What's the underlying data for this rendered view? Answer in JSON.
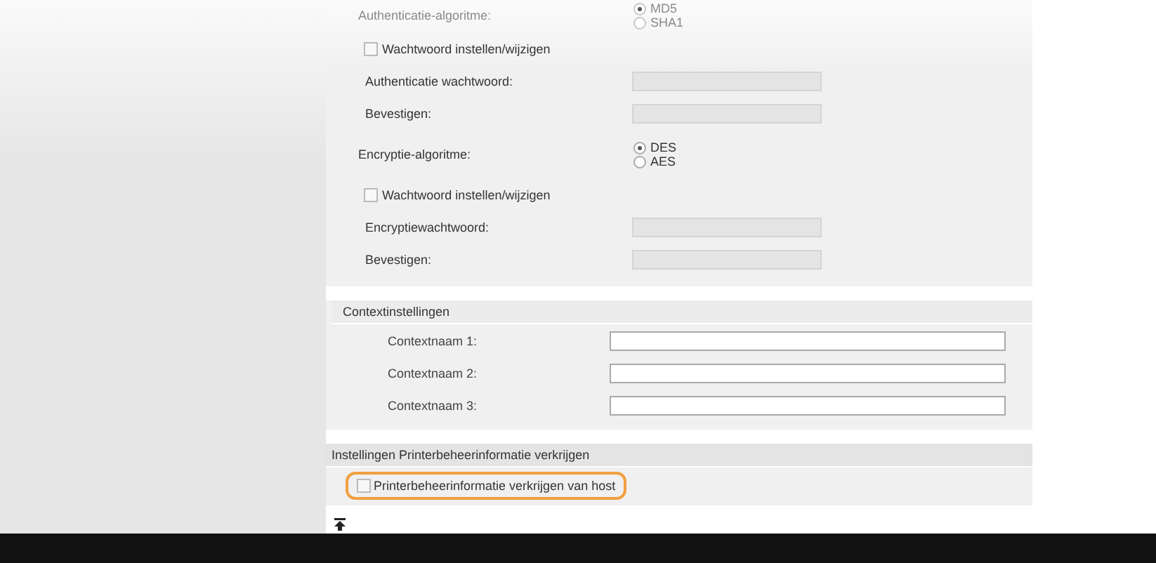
{
  "snmp_panel": {
    "items": [
      {
        "kind": "radio",
        "label": "Authenticatie-algoritme:",
        "faded": true,
        "options": [
          {
            "label": "MD5",
            "selected": true
          },
          {
            "label": "SHA1",
            "selected": false
          }
        ]
      },
      {
        "kind": "checkbox",
        "label": "Wachtwoord instellen/wijzigen",
        "checked": false
      },
      {
        "kind": "field",
        "label": "Authenticatie wachtwoord:",
        "disabled": true
      },
      {
        "kind": "field",
        "label": "Bevestigen:",
        "disabled": true
      },
      {
        "kind": "radio",
        "label": "Encryptie-algoritme:",
        "faded": false,
        "options": [
          {
            "label": "DES",
            "selected": true
          },
          {
            "label": "AES",
            "selected": false
          }
        ]
      },
      {
        "kind": "checkbox",
        "label": "Wachtwoord instellen/wijzigen",
        "checked": false
      },
      {
        "kind": "field",
        "label": "Encryptiewachtwoord:",
        "disabled": true
      },
      {
        "kind": "field",
        "label": "Bevestigen:",
        "disabled": true
      }
    ]
  },
  "context_settings": {
    "title": "Contextinstellingen",
    "fields": [
      {
        "label": "Contextnaam 1:",
        "disabled": false
      },
      {
        "label": "Contextnaam 2:",
        "disabled": false
      },
      {
        "label": "Contextnaam 3:",
        "disabled": false
      }
    ]
  },
  "printer_info": {
    "title": "Instellingen Printerbeheerinformatie verkrijgen",
    "checkbox": {
      "label": "Printerbeheerinformatie verkrijgen van host",
      "checked": false,
      "highlighted": true
    }
  }
}
